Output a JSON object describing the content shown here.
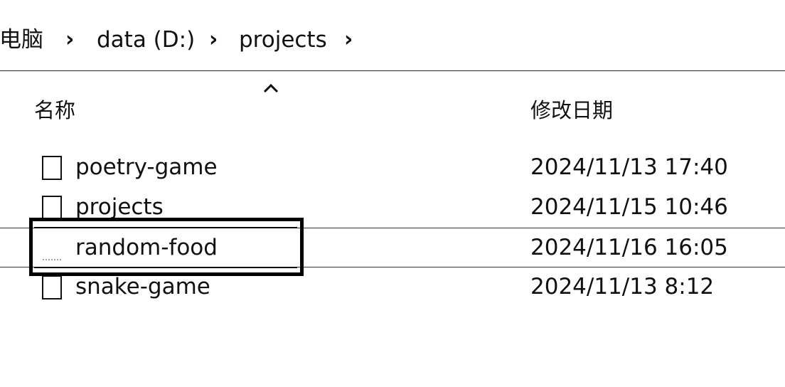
{
  "breadcrumb": {
    "items": [
      "此电脑",
      "data (D:)",
      "projects"
    ],
    "separator": "›"
  },
  "columns": {
    "name": "名称",
    "modified": "修改日期",
    "sort_indicator": "chevron-up-icon"
  },
  "files": [
    {
      "name": "poetry-game",
      "modified": "2024/11/13 17:40",
      "icon": "file-icon"
    },
    {
      "name": "projects",
      "modified": "2024/11/15 10:46",
      "icon": "file-icon"
    },
    {
      "name": "random-food",
      "modified": "2024/11/16 16:05",
      "icon": "file-icon",
      "selected": true
    },
    {
      "name": "snake-game",
      "modified": "2024/11/13 8:12",
      "icon": "file-icon"
    }
  ]
}
